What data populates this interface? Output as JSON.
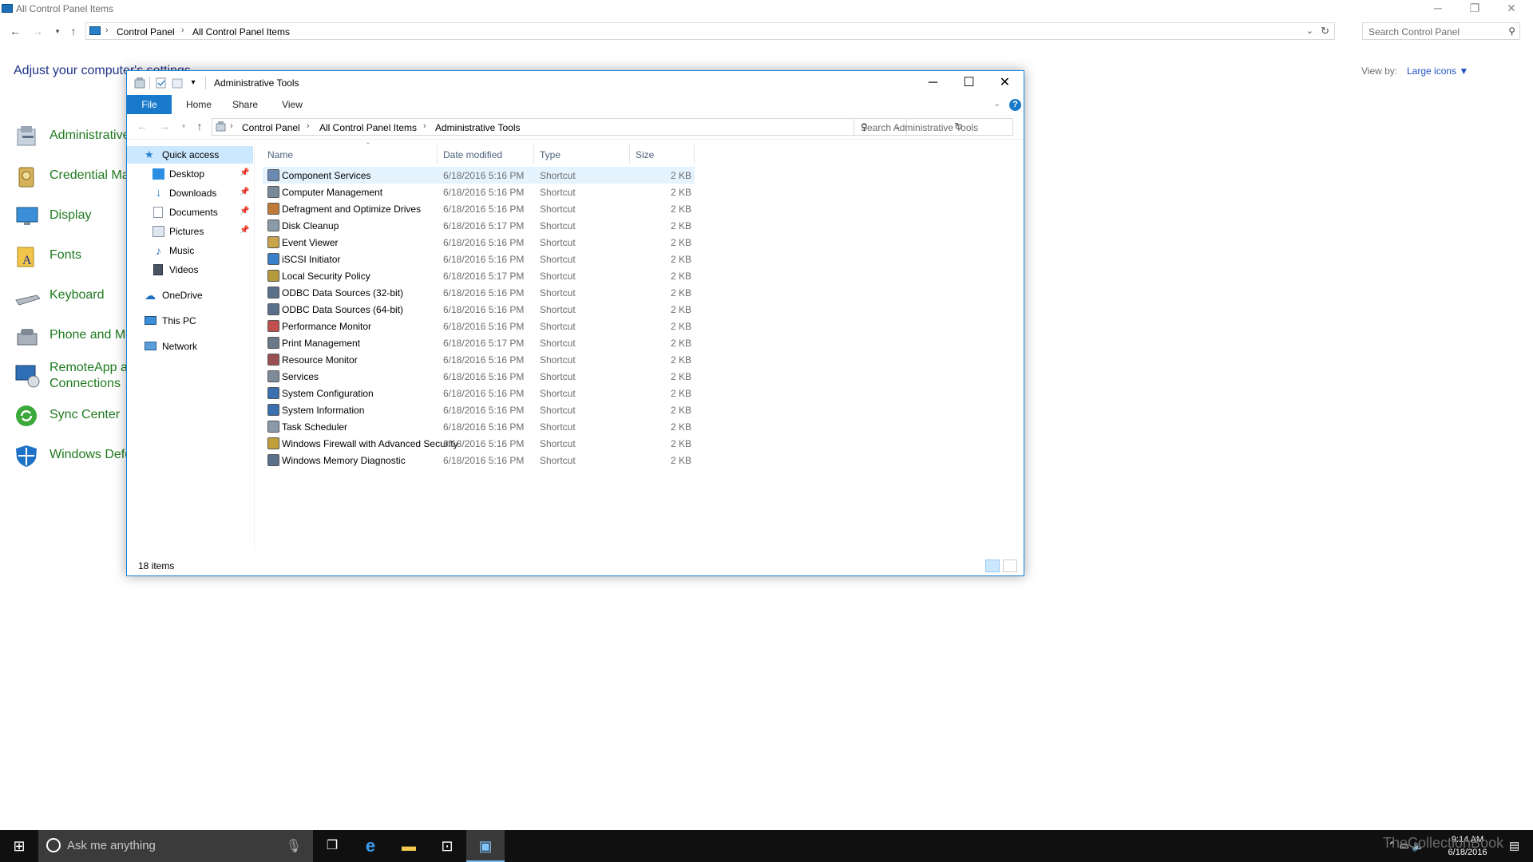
{
  "background": {
    "title": "All Control Panel Items",
    "breadcrumb": [
      "Control Panel",
      "All Control Panel Items"
    ],
    "search_placeholder": "Search Control Panel",
    "heading": "Adjust your computer's settings",
    "view_by_label": "View by:",
    "view_by_value": "Large icons ▼",
    "items": [
      {
        "label": "Administrative",
        "icon": "admin-tools-icon"
      },
      {
        "label": "Credential Ma",
        "icon": "credential-manager-icon"
      },
      {
        "label": "Display",
        "icon": "display-icon"
      },
      {
        "label": "Fonts",
        "icon": "fonts-icon"
      },
      {
        "label": "Keyboard",
        "icon": "keyboard-icon"
      },
      {
        "label": "Phone and Mo",
        "icon": "phone-modem-icon"
      },
      {
        "label": "RemoteApp a",
        "label2": "Connections",
        "icon": "remoteapp-icon"
      },
      {
        "label": "Sync Center",
        "icon": "sync-center-icon"
      },
      {
        "label": "Windows Defe",
        "icon": "windows-defender-icon"
      }
    ]
  },
  "explorer": {
    "title": "Administrative Tools",
    "ribbon_tabs": [
      "File",
      "Home",
      "Share",
      "View"
    ],
    "breadcrumb": [
      "Control Panel",
      "All Control Panel Items",
      "Administrative Tools"
    ],
    "search_placeholder": "Search Administrative Tools",
    "nav": [
      {
        "label": "Quick access",
        "icon": "star-icon",
        "pinned": false,
        "selected": true
      },
      {
        "label": "Desktop",
        "icon": "desktop-folder-icon",
        "pinned": true
      },
      {
        "label": "Downloads",
        "icon": "downloads-folder-icon",
        "pinned": true
      },
      {
        "label": "Documents",
        "icon": "documents-folder-icon",
        "pinned": true
      },
      {
        "label": "Pictures",
        "icon": "pictures-folder-icon",
        "pinned": true
      },
      {
        "label": "Music",
        "icon": "music-folder-icon",
        "pinned": false
      },
      {
        "label": "Videos",
        "icon": "videos-folder-icon",
        "pinned": false
      },
      {
        "label": "OneDrive",
        "icon": "onedrive-icon",
        "pinned": false
      },
      {
        "label": "This PC",
        "icon": "this-pc-icon",
        "pinned": false
      },
      {
        "label": "Network",
        "icon": "network-icon",
        "pinned": false
      }
    ],
    "columns": [
      "Name",
      "Date modified",
      "Type",
      "Size"
    ],
    "files": [
      {
        "name": "Component Services",
        "date": "6/18/2016 5:16 PM",
        "type": "Shortcut",
        "size": "2 KB"
      },
      {
        "name": "Computer Management",
        "date": "6/18/2016 5:16 PM",
        "type": "Shortcut",
        "size": "2 KB"
      },
      {
        "name": "Defragment and Optimize Drives",
        "date": "6/18/2016 5:16 PM",
        "type": "Shortcut",
        "size": "2 KB"
      },
      {
        "name": "Disk Cleanup",
        "date": "6/18/2016 5:17 PM",
        "type": "Shortcut",
        "size": "2 KB"
      },
      {
        "name": "Event Viewer",
        "date": "6/18/2016 5:16 PM",
        "type": "Shortcut",
        "size": "2 KB"
      },
      {
        "name": "iSCSI Initiator",
        "date": "6/18/2016 5:16 PM",
        "type": "Shortcut",
        "size": "2 KB"
      },
      {
        "name": "Local Security Policy",
        "date": "6/18/2016 5:17 PM",
        "type": "Shortcut",
        "size": "2 KB"
      },
      {
        "name": "ODBC Data Sources (32-bit)",
        "date": "6/18/2016 5:16 PM",
        "type": "Shortcut",
        "size": "2 KB"
      },
      {
        "name": "ODBC Data Sources (64-bit)",
        "date": "6/18/2016 5:16 PM",
        "type": "Shortcut",
        "size": "2 KB"
      },
      {
        "name": "Performance Monitor",
        "date": "6/18/2016 5:16 PM",
        "type": "Shortcut",
        "size": "2 KB"
      },
      {
        "name": "Print Management",
        "date": "6/18/2016 5:17 PM",
        "type": "Shortcut",
        "size": "2 KB"
      },
      {
        "name": "Resource Monitor",
        "date": "6/18/2016 5:16 PM",
        "type": "Shortcut",
        "size": "2 KB"
      },
      {
        "name": "Services",
        "date": "6/18/2016 5:16 PM",
        "type": "Shortcut",
        "size": "2 KB"
      },
      {
        "name": "System Configuration",
        "date": "6/18/2016 5:16 PM",
        "type": "Shortcut",
        "size": "2 KB"
      },
      {
        "name": "System Information",
        "date": "6/18/2016 5:16 PM",
        "type": "Shortcut",
        "size": "2 KB"
      },
      {
        "name": "Task Scheduler",
        "date": "6/18/2016 5:16 PM",
        "type": "Shortcut",
        "size": "2 KB"
      },
      {
        "name": "Windows Firewall with Advanced Security",
        "date": "6/18/2016 5:16 PM",
        "type": "Shortcut",
        "size": "2 KB"
      },
      {
        "name": "Windows Memory Diagnostic",
        "date": "6/18/2016 5:16 PM",
        "type": "Shortcut",
        "size": "2 KB"
      }
    ],
    "status": "18 items"
  },
  "taskbar": {
    "search_placeholder": "Ask me anything",
    "time": "9:14 AM",
    "date": "6/18/2016"
  },
  "watermark": "TheCollectionBook",
  "colors": {
    "accent": "#1979ca",
    "link_green": "#1e7a1e",
    "heading_blue": "#1e3287",
    "selection": "#e5f3ff"
  }
}
